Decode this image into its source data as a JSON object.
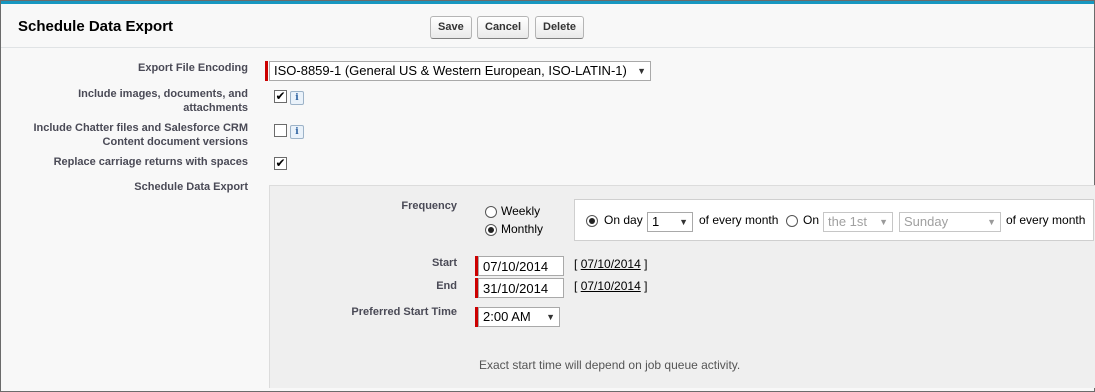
{
  "header": {
    "title": "Schedule Data Export",
    "buttons": {
      "save": "Save",
      "cancel": "Cancel",
      "delete": "Delete"
    }
  },
  "form": {
    "encoding": {
      "label": "Export File Encoding",
      "value": "ISO-8859-1 (General US & Western European, ISO-LATIN-1)"
    },
    "include_images": {
      "label_line1": "Include images, documents, and",
      "label_line2": "attachments",
      "checked": true,
      "info_icon": "i"
    },
    "include_chatter": {
      "label_line1": "Include Chatter files and Salesforce CRM",
      "label_line2": "Content document versions",
      "checked": false,
      "info_icon": "i"
    },
    "replace_returns": {
      "label": "Replace carriage returns with spaces",
      "checked": true
    },
    "schedule_label": "Schedule Data Export"
  },
  "schedule": {
    "frequency_label": "Frequency",
    "weekly": "Weekly",
    "monthly": "Monthly",
    "selected_frequency": "Monthly",
    "on_day_label": "On day",
    "day_value": "1",
    "of_every_month": "of every month",
    "on_label": "On",
    "ordinal_value": "the 1st",
    "weekday_value": "Sunday",
    "of_every_month_2": "of every month",
    "start_label": "Start",
    "start_value": "07/10/2014",
    "start_link": "07/10/2014",
    "end_label": "End",
    "end_value": "31/10/2014",
    "end_link": "07/10/2014",
    "bracket_open": "[",
    "bracket_close": "]",
    "preferred_label": "Preferred Start Time",
    "preferred_value": "2:00 AM",
    "note": "Exact start time will depend on job queue activity."
  },
  "colors": {
    "accent_top": "#1797c0",
    "required": "#cc0000",
    "label_text": "#4a4a56"
  },
  "icons": {
    "dropdown": "chevron-down-icon",
    "info": "info-icon",
    "check": "checkmark-icon"
  }
}
